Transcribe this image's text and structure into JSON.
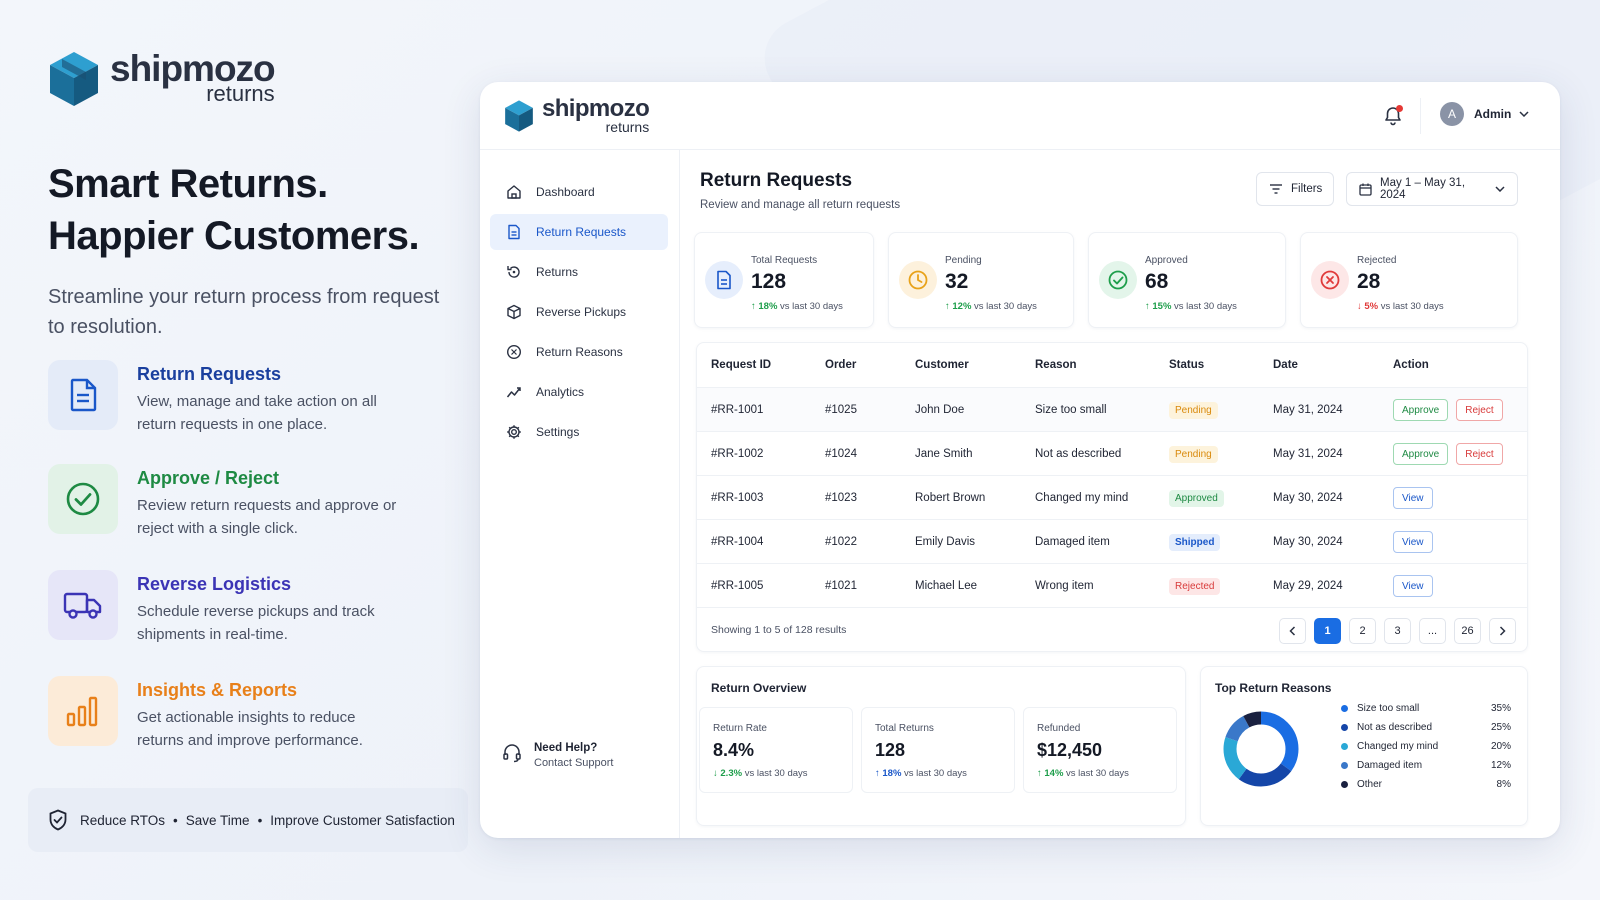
{
  "brand": {
    "name": "shipmozo",
    "product": "returns"
  },
  "hero": {
    "title_line1": "Smart Returns.",
    "title_line2": "Happier Customers.",
    "subtitle": "Streamline your return process from request to resolution."
  },
  "features": [
    {
      "title": "Return Requests",
      "desc": "View, manage and take action on all return requests in one place.",
      "icon": "document-icon",
      "color": "#1a57c9"
    },
    {
      "title": "Approve / Reject",
      "desc": "Review return requests and approve or reject with a single click.",
      "icon": "check-circle-icon",
      "color": "#1e8a43"
    },
    {
      "title": "Reverse Logistics",
      "desc": "Schedule reverse pickups and track shipments in real-time.",
      "icon": "truck-icon",
      "color": "#3b34b5"
    },
    {
      "title": "Insights & Reports",
      "desc": "Get actionable insights to reduce returns and improve performance.",
      "icon": "bar-chart-icon",
      "color": "#e8801a"
    }
  ],
  "tagline": {
    "item1": "Reduce RTOs",
    "item2": "Save Time",
    "item3": "Improve Customer Satisfaction",
    "separator": "•"
  },
  "header": {
    "user_initial": "A",
    "user_name": "Admin"
  },
  "sidebar": {
    "items": [
      {
        "label": "Dashboard",
        "icon": "home-icon"
      },
      {
        "label": "Return Requests",
        "icon": "document-icon",
        "active": true
      },
      {
        "label": "Returns",
        "icon": "return-icon"
      },
      {
        "label": "Reverse Pickups",
        "icon": "box-icon"
      },
      {
        "label": "Return Reasons",
        "icon": "reason-icon"
      },
      {
        "label": "Analytics",
        "icon": "analytics-icon"
      },
      {
        "label": "Settings",
        "icon": "gear-icon"
      }
    ],
    "help": {
      "title": "Need Help?",
      "link": "Contact Support"
    }
  },
  "page": {
    "title": "Return Requests",
    "subtitle": "Review and manage all return requests",
    "filters_label": "Filters",
    "date_range": "May 1 – May 31, 2024"
  },
  "stats": [
    {
      "label": "Total Requests",
      "value": "128",
      "trend_pct": "18%",
      "trend_dir": "up",
      "trend_text": "vs last 30 days",
      "color": "#1a57c9",
      "bg": "#e6eefc"
    },
    {
      "label": "Pending",
      "value": "32",
      "trend_pct": "12%",
      "trend_dir": "up",
      "trend_text": "vs last 30 days",
      "color": "#e8a21a",
      "bg": "#fdf1dc"
    },
    {
      "label": "Approved",
      "value": "68",
      "trend_pct": "15%",
      "trend_dir": "up",
      "trend_text": "vs last 30 days",
      "color": "#1e9e4b",
      "bg": "#e3f5ea"
    },
    {
      "label": "Rejected",
      "value": "28",
      "trend_pct": "5%",
      "trend_dir": "down",
      "trend_text": "vs last 30 days",
      "color": "#e03a3a",
      "bg": "#fde7e7"
    }
  ],
  "table": {
    "columns": [
      "Request ID",
      "Order",
      "Customer",
      "Reason",
      "Status",
      "Date",
      "Action"
    ],
    "rows": [
      {
        "id": "#RR-1001",
        "order": "#1025",
        "customer": "John Doe",
        "reason": "Size too small",
        "status": "Pending",
        "date": "May 31, 2024",
        "actions": [
          "Approve",
          "Reject"
        ]
      },
      {
        "id": "#RR-1002",
        "order": "#1024",
        "customer": "Jane Smith",
        "reason": "Not as described",
        "status": "Pending",
        "date": "May 31, 2024",
        "actions": [
          "Approve",
          "Reject"
        ]
      },
      {
        "id": "#RR-1003",
        "order": "#1023",
        "customer": "Robert Brown",
        "reason": "Changed my mind",
        "status": "Approved",
        "date": "May 30, 2024",
        "actions": [
          "View"
        ]
      },
      {
        "id": "#RR-1004",
        "order": "#1022",
        "customer": "Emily Davis",
        "reason": "Damaged item",
        "status": "Shipped",
        "date": "May 30, 2024",
        "actions": [
          "View"
        ]
      },
      {
        "id": "#RR-1005",
        "order": "#1021",
        "customer": "Michael Lee",
        "reason": "Wrong item",
        "status": "Rejected",
        "date": "May 29, 2024",
        "actions": [
          "View"
        ]
      }
    ],
    "showing": "Showing 1 to 5 of 128 results",
    "pagination": [
      "1",
      "2",
      "3",
      "...",
      "26"
    ],
    "current_page": "1"
  },
  "overview": {
    "title": "Return Overview",
    "items": [
      {
        "label": "Return Rate",
        "value": "8.4%",
        "trend_pct": "2.3%",
        "trend_dir": "down",
        "trend_text": "vs last 30 days"
      },
      {
        "label": "Total Returns",
        "value": "128",
        "trend_pct": "18%",
        "trend_dir": "up",
        "trend_text": "vs last 30 days"
      },
      {
        "label": "Refunded",
        "value": "$12,450",
        "trend_pct": "14%",
        "trend_dir": "up",
        "trend_text": "vs last 30 days"
      }
    ]
  },
  "reasons": {
    "title": "Top Return Reasons",
    "items": [
      {
        "label": "Size too small",
        "pct": "35%",
        "value": 35,
        "color": "#1a6de3"
      },
      {
        "label": "Not as described",
        "pct": "25%",
        "value": 25,
        "color": "#1546a8"
      },
      {
        "label": "Changed my mind",
        "pct": "20%",
        "value": 20,
        "color": "#2aa8d6"
      },
      {
        "label": "Damaged item",
        "pct": "12%",
        "value": 12,
        "color": "#3a78c9"
      },
      {
        "label": "Other",
        "pct": "8%",
        "value": 8,
        "color": "#1a2140"
      }
    ]
  }
}
